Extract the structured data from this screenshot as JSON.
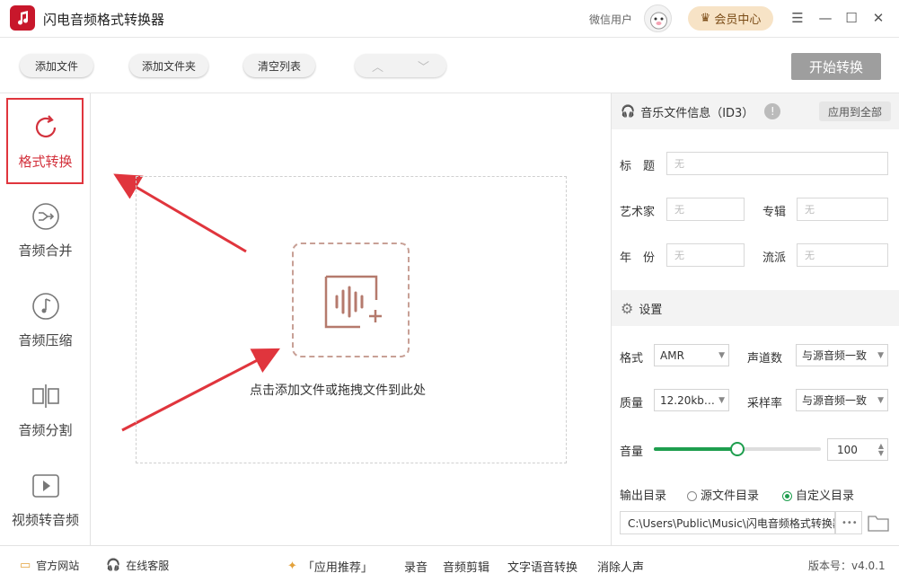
{
  "app": {
    "title": "闪电音频格式转换器",
    "username": "微信用户",
    "vip_label": "会员中心"
  },
  "toolbar": {
    "add_file": "添加文件",
    "add_folder": "添加文件夹",
    "clear_list": "清空列表",
    "start": "开始转换"
  },
  "sidebar": {
    "items": [
      {
        "label": "格式转换",
        "icon": "refresh-icon"
      },
      {
        "label": "音频合并",
        "icon": "merge-icon"
      },
      {
        "label": "音频压缩",
        "icon": "music-note-icon"
      },
      {
        "label": "音频分割",
        "icon": "split-icon"
      },
      {
        "label": "视频转音频",
        "icon": "play-icon"
      }
    ]
  },
  "main": {
    "drop_text": "点击添加文件或拖拽文件到此处"
  },
  "id3": {
    "heading": "音乐文件信息（ID3）",
    "apply_all": "应用到全部",
    "title_label": "标　题",
    "artist_label": "艺术家",
    "album_label": "专辑",
    "year_label": "年　份",
    "genre_label": "流派",
    "empty": "无"
  },
  "settings": {
    "heading": "设置",
    "format_label": "格式",
    "format_value": "AMR",
    "channels_label": "声道数",
    "channels_value": "与源音频一致",
    "quality_label": "质量",
    "quality_value": "12.20kb…",
    "samplerate_label": "采样率",
    "samplerate_value": "与源音频一致",
    "volume_label": "音量",
    "volume_value": "100",
    "volume_fraction": 0.5,
    "output_label": "输出目录",
    "output_source": "源文件目录",
    "output_custom": "自定义目录",
    "output_path": "C:\\Users\\Public\\Music\\闪电音频格式转换器",
    "more": "•••"
  },
  "footer": {
    "website": "官方网站",
    "service": "在线客服",
    "recommend": "「应用推荐」",
    "links": [
      "录音",
      "音频剪辑",
      "文字语音转换",
      "消除人声"
    ],
    "version": "版本号：v4.0.1"
  },
  "colors": {
    "accent": "#e0353d",
    "green": "#1e9e4e",
    "vip_bg": "#f7e3c6",
    "start_bg": "#9e9e9e"
  }
}
